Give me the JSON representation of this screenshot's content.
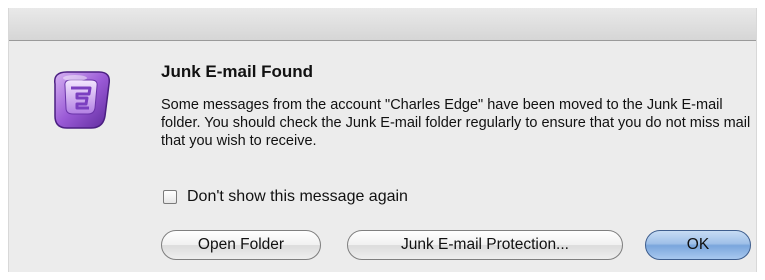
{
  "dialog": {
    "heading": "Junk E-mail Found",
    "message": "Some messages from the account \"Charles Edge\" have been moved to the Junk E-mail folder. You should check the Junk E-mail folder regularly to ensure that you do not miss mail that you wish to receive.",
    "icon": "entourage-app-icon",
    "checkbox": {
      "label": "Don't show this message again",
      "checked": false
    },
    "buttons": {
      "open_folder": "Open Folder",
      "junk_protection": "Junk E-mail Protection...",
      "ok": "OK"
    }
  },
  "colors": {
    "icon_purple": "#8a4fc8",
    "default_button_blue": "#7aa6dc"
  }
}
